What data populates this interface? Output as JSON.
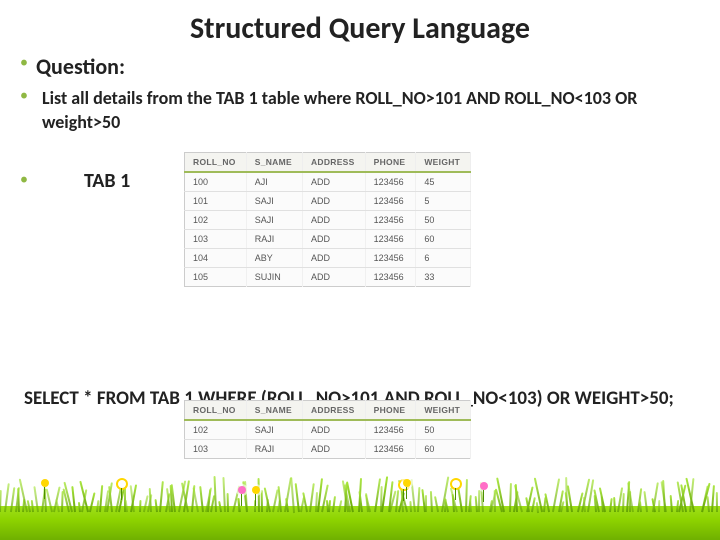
{
  "title": "Structured Query Language",
  "question_label": "Question:",
  "question_text": "List all details from the TAB 1 table where ROLL_NO>101 AND ROLL_NO<103 OR weight>50",
  "tab1_label": "TAB 1",
  "sql": "SELECT * FROM TAB 1 WHERE (ROLL_NO>101 AND ROLL_NO<103) OR WEIGHT>50;",
  "table1": {
    "headers": [
      "ROLL_NO",
      "S_NAME",
      "ADDRESS",
      "PHONE",
      "WEIGHT"
    ],
    "rows": [
      [
        "100",
        "AJI",
        "ADD",
        "123456",
        "45"
      ],
      [
        "101",
        "SAJI",
        "ADD",
        "123456",
        "5"
      ],
      [
        "102",
        "SAJI",
        "ADD",
        "123456",
        "50"
      ],
      [
        "103",
        "RAJI",
        "ADD",
        "123456",
        "60"
      ],
      [
        "104",
        "ABY",
        "ADD",
        "123456",
        "6"
      ],
      [
        "105",
        "SUJIN",
        "ADD",
        "123456",
        "33"
      ]
    ]
  },
  "table2": {
    "headers": [
      "ROLL_NO",
      "S_NAME",
      "ADDRESS",
      "PHONE",
      "WEIGHT"
    ],
    "rows": [
      [
        "102",
        "SAJI",
        "ADD",
        "123456",
        "50"
      ],
      [
        "103",
        "RAJI",
        "ADD",
        "123456",
        "60"
      ]
    ]
  }
}
